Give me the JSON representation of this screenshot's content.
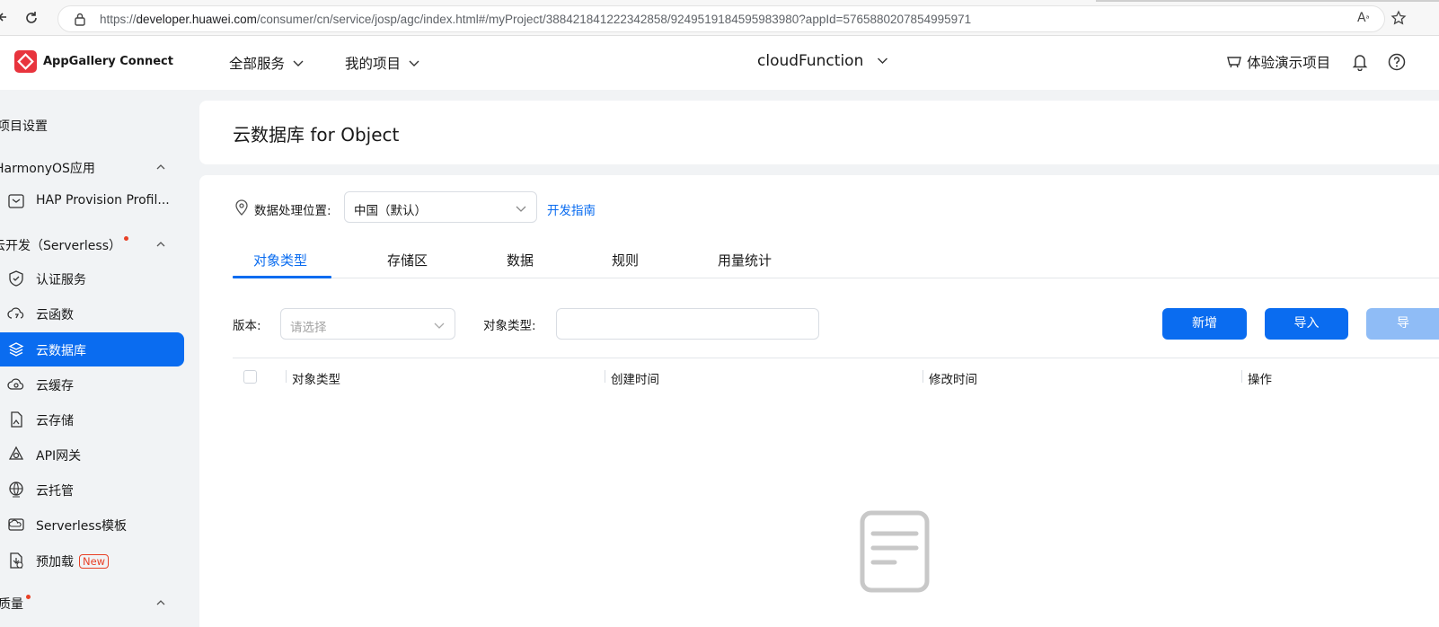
{
  "browser": {
    "url_prefix": "https://",
    "url_domain": "developer.huawei.com",
    "url_rest": "/consumer/cn/service/josp/agc/index.html#/myProject/388421841222342858/9249519184595983980?appId=5765880207854995971"
  },
  "header": {
    "brand": "AppGallery Connect",
    "nav_all_services": "全部服务",
    "nav_my_projects": "我的项目",
    "project_name": "cloudFunction",
    "demo_project": "体验演示项目"
  },
  "sidebar": {
    "project_settings": "项目设置",
    "harmony_section": "HarmonyOS应用",
    "hap_provision": "HAP Provision Profil...",
    "serverless_section": "云开发（Serverless）",
    "items": [
      {
        "label": "认证服务"
      },
      {
        "label": "云函数"
      },
      {
        "label": "云数据库"
      },
      {
        "label": "云缓存"
      },
      {
        "label": "云存储"
      },
      {
        "label": "API网关"
      },
      {
        "label": "云托管"
      },
      {
        "label": "Serverless模板"
      },
      {
        "label": "预加载"
      }
    ],
    "new_badge": "New",
    "quality_section": "质量"
  },
  "page": {
    "title": "云数据库 for Object",
    "location_label": "数据处理位置:",
    "location_value": "中国（默认）",
    "dev_guide": "开发指南",
    "tabs": [
      {
        "label": "对象类型"
      },
      {
        "label": "存储区"
      },
      {
        "label": "数据"
      },
      {
        "label": "规则"
      },
      {
        "label": "用量统计"
      }
    ],
    "active_tab": "对象类型",
    "filter_version_label": "版本:",
    "filter_version_placeholder": "请选择",
    "filter_type_label": "对象类型:",
    "filter_type_value": "",
    "btn_add": "新增",
    "btn_import": "导入",
    "btn_export": "导",
    "table_headers": {
      "type": "对象类型",
      "created": "创建时间",
      "modified": "修改时间",
      "actions": "操作"
    }
  },
  "colors": {
    "accent": "#0a6cf0",
    "badge_red": "#e84026",
    "disabled_blue": "#8fbcf6"
  }
}
